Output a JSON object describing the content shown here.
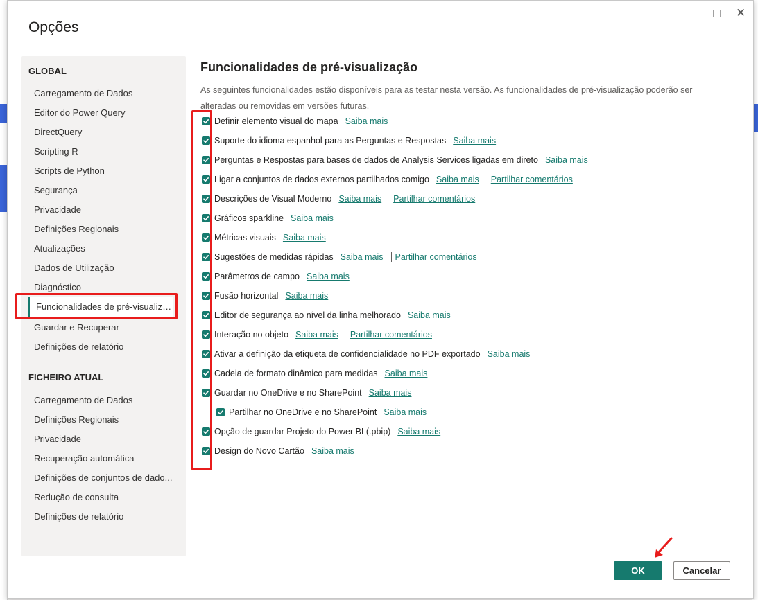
{
  "dialog": {
    "title": "Opções",
    "maximize_icon": "☐",
    "close_icon": "✕"
  },
  "sidebar": {
    "global_heading": "GLOBAL",
    "global_items": [
      "Carregamento de Dados",
      "Editor do Power Query",
      "DirectQuery",
      "Scripting R",
      "Scripts de Python",
      "Segurança",
      "Privacidade",
      "Definições Regionais",
      "Atualizações",
      "Dados de Utilização",
      "Diagnóstico",
      "Funcionalidades de pré-visualizaç...",
      "Guardar e Recuperar",
      "Definições de relatório"
    ],
    "current_heading": "FICHEIRO ATUAL",
    "current_items": [
      "Carregamento de Dados",
      "Definições Regionais",
      "Privacidade",
      "Recuperação automática",
      "Definições de conjuntos de dado...",
      "Redução de consulta",
      "Definições de relatório"
    ]
  },
  "content": {
    "heading": "Funcionalidades de pré-visualização",
    "description": "As seguintes funcionalidades estão disponíveis para as testar nesta versão. As funcionalidades de pré-visualização poderão ser alteradas ou removidas em versões futuras.",
    "features": [
      {
        "label": "Definir elemento visual do mapa",
        "link": "Saiba mais",
        "checked": true
      },
      {
        "label": "Suporte do idioma espanhol para as Perguntas e Respostas",
        "link": "Saiba mais",
        "checked": true
      },
      {
        "label": "Perguntas e Respostas para bases de dados de Analysis Services ligadas em direto",
        "link": "Saiba mais",
        "checked": true
      },
      {
        "label": "Ligar a conjuntos de dados externos partilhados comigo",
        "link": "Saiba mais",
        "feedback": "Partilhar comentários",
        "checked": true
      },
      {
        "label": "Descrições de Visual Moderno",
        "link": "Saiba mais",
        "feedback": "Partilhar comentários",
        "checked": true
      },
      {
        "label": "Gráficos sparkline",
        "link": "Saiba mais",
        "checked": true
      },
      {
        "label": "Métricas visuais",
        "link": "Saiba mais",
        "checked": true
      },
      {
        "label": "Sugestões de medidas rápidas",
        "link": "Saiba mais",
        "feedback": "Partilhar comentários",
        "checked": true
      },
      {
        "label": "Parâmetros de campo",
        "link": "Saiba mais",
        "checked": true
      },
      {
        "label": "Fusão horizontal",
        "link": "Saiba mais",
        "checked": true
      },
      {
        "label": "Editor de segurança ao nível da linha melhorado",
        "link": "Saiba mais",
        "checked": true
      },
      {
        "label": "Interação no objeto",
        "link": "Saiba mais",
        "feedback": "Partilhar comentários",
        "checked": true
      },
      {
        "label": "Ativar a definição da etiqueta de confidencialidade no PDF exportado",
        "link": "Saiba mais",
        "checked": true
      },
      {
        "label": "Cadeia de formato dinâmico para medidas",
        "link": "Saiba mais",
        "checked": true
      },
      {
        "label": "Guardar no OneDrive e no SharePoint",
        "link": "Saiba mais",
        "checked": true
      },
      {
        "label": "Partilhar no OneDrive e no SharePoint",
        "link": "Saiba mais",
        "checked": true,
        "nested": true
      },
      {
        "label": "Opção de guardar Projeto do Power BI (.pbip)",
        "link": "Saiba mais",
        "checked": true
      },
      {
        "label": "Design do Novo Cartão",
        "link": "Saiba mais",
        "checked": true
      }
    ]
  },
  "footer": {
    "ok_label": "OK",
    "cancel_label": "Cancelar"
  },
  "colors": {
    "accent": "#167a6e",
    "highlight": "#e81c1c"
  }
}
